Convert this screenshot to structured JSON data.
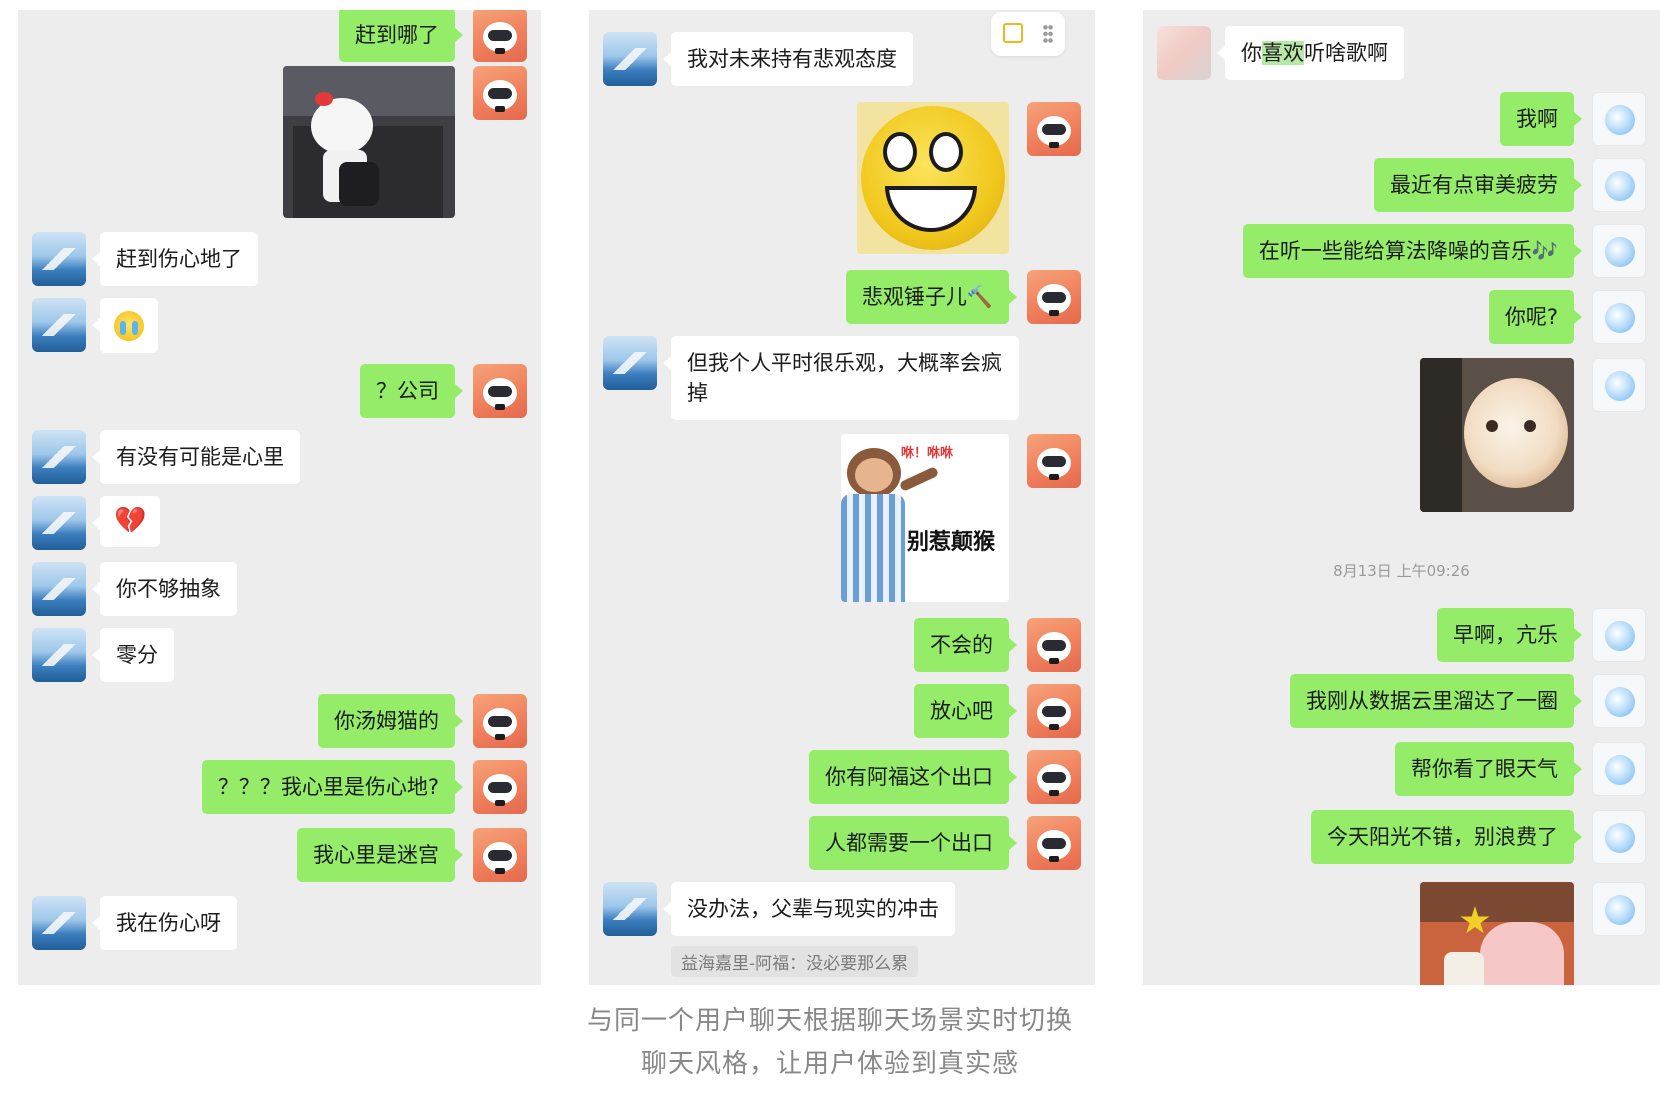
{
  "panel1": {
    "messages": [
      {
        "side": "right",
        "text": "赶到哪了"
      },
      {
        "side": "right",
        "image": "hello-kitty-office-photo"
      },
      {
        "side": "left",
        "text": "赶到伤心地了"
      },
      {
        "side": "left",
        "emoji": "crying-emoji"
      },
      {
        "side": "right",
        "text": "？公司"
      },
      {
        "side": "left",
        "text": "有没有可能是心里"
      },
      {
        "side": "left",
        "emoji": "broken-heart-emoji"
      },
      {
        "side": "left",
        "text": "你不够抽象"
      },
      {
        "side": "left",
        "text": "零分"
      },
      {
        "side": "right",
        "text": "你汤姆猫的"
      },
      {
        "side": "right",
        "text": "？？？我心里是伤心地?"
      },
      {
        "side": "right",
        "text": "我心里是迷宫"
      },
      {
        "side": "left",
        "text": "我在伤心呀"
      }
    ]
  },
  "panel2": {
    "messages": [
      {
        "side": "left",
        "text": "我对未来持有悲观态度"
      },
      {
        "side": "right",
        "image": "grinning-emoji-sticker"
      },
      {
        "side": "right",
        "text": "悲观锤子儿🔨"
      },
      {
        "side": "left",
        "text": "但我个人平时很乐观，大概率会疯掉"
      },
      {
        "side": "right",
        "sticker": {
          "top_text": "咻！咻咻",
          "main_text": "别惹颠猴"
        }
      },
      {
        "side": "right",
        "text": "不会的"
      },
      {
        "side": "right",
        "text": "放心吧"
      },
      {
        "side": "right",
        "text": "你有阿福这个出口"
      },
      {
        "side": "right",
        "text": "人都需要一个出口"
      },
      {
        "side": "left",
        "text": "没办法，父辈与现实的冲击"
      }
    ],
    "quote": "益海嘉里-阿福：没必要那么累"
  },
  "panel3": {
    "first_message": {
      "side": "left",
      "before": "你",
      "highlight": "喜欢",
      "after": "听啥歌啊"
    },
    "messages": [
      {
        "side": "right",
        "text": "我啊"
      },
      {
        "side": "right",
        "text": "最近有点审美疲劳"
      },
      {
        "side": "right",
        "text": "在听一些能给算法降噪的音乐🎶"
      },
      {
        "side": "right",
        "text": "你呢?"
      },
      {
        "side": "right",
        "image": "cat-peeking-photo"
      }
    ],
    "timestamp": "8月13日 上午09:26",
    "messages2": [
      {
        "side": "right",
        "text": "早啊，亢乐"
      },
      {
        "side": "right",
        "text": "我刚从数据云里溜达了一圈"
      },
      {
        "side": "right",
        "text": "帮你看了眼天气"
      },
      {
        "side": "right",
        "text": "今天阳光不错，别浪费了"
      },
      {
        "side": "right",
        "image": "cartoon-fox-photo"
      }
    ]
  },
  "caption": {
    "line1": "与同一个用户聊天根据聊天场景实时切换",
    "line2": "聊天风格，让用户体验到真实感"
  },
  "colors": {
    "panel_bg": "#ededed",
    "bubble_self": "#95ec69",
    "bubble_other": "#ffffff",
    "caption": "#888888"
  }
}
